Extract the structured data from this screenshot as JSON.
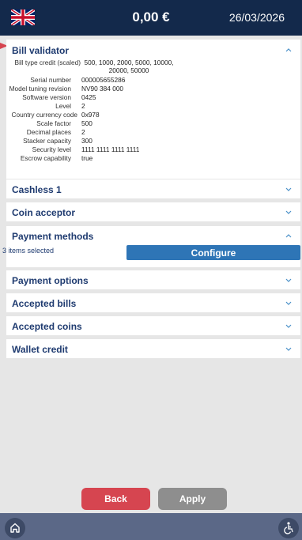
{
  "header": {
    "balance": "0,00 €",
    "date": "26/03/2026",
    "flag_icon": "uk-flag-icon"
  },
  "colors": {
    "header_bg": "#13294b",
    "accent": "#2e75b6",
    "back": "#d64550",
    "apply": "#8e8e8e",
    "bottom_bar": "#5b6887"
  },
  "sections": [
    {
      "title": "Bill validator",
      "expanded": true,
      "rows": [
        {
          "label": "Bill type credit (scaled)",
          "value": "500, 1000, 2000, 5000, 10000, 20000, 50000"
        },
        {
          "label": "Serial number",
          "value": "000005655286"
        },
        {
          "label": "Model tuning revision",
          "value": "NV90 384 000"
        },
        {
          "label": "Software version",
          "value": "0425"
        },
        {
          "label": "Level",
          "value": "2"
        },
        {
          "label": "Country currency code",
          "value": "0x978"
        },
        {
          "label": "Scale factor",
          "value": "500"
        },
        {
          "label": "Decimal places",
          "value": "2"
        },
        {
          "label": "Stacker capacity",
          "value": "300"
        },
        {
          "label": "Security level",
          "value": "1111 1111 1111 1111"
        },
        {
          "label": "Escrow capability",
          "value": "true"
        }
      ]
    },
    {
      "title": "Cashless 1",
      "expanded": false
    },
    {
      "title": "Coin acceptor",
      "expanded": false
    },
    {
      "title": "Payment methods",
      "expanded": true,
      "items_selected": "3 items selected",
      "configure_label": "Configure"
    },
    {
      "title": "Payment options",
      "expanded": false
    },
    {
      "title": "Accepted bills",
      "expanded": false
    },
    {
      "title": "Accepted coins",
      "expanded": false
    },
    {
      "title": "Wallet credit",
      "expanded": false
    }
  ],
  "footer": {
    "back_label": "Back",
    "apply_label": "Apply"
  },
  "bottom_bar": {
    "home_icon": "home-icon",
    "accessibility_icon": "accessibility-icon"
  }
}
